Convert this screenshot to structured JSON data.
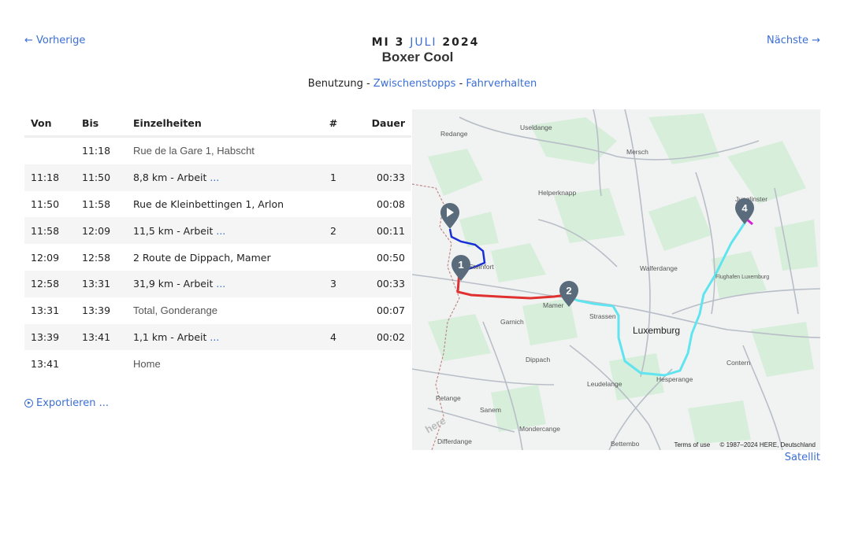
{
  "nav": {
    "prev": "← Vorherige",
    "next": "Nächste →"
  },
  "title": {
    "weekday_day": "MI 3",
    "month": "JULI",
    "year": "2024",
    "vehicle": "Boxer Cool"
  },
  "tabs": {
    "usage": "Benutzung",
    "sep1": " - ",
    "stops": "Zwischenstopps",
    "sep2": " - ",
    "driving": "Fahrverhalten"
  },
  "table": {
    "headers": {
      "from": "Von",
      "to": "Bis",
      "details": "Einzelheiten",
      "num": "#",
      "duration": "Dauer"
    },
    "rows": [
      {
        "from": "",
        "to": "11:18",
        "details": "Rue de la Gare 1, Habscht",
        "more": "",
        "num": "",
        "duration": ""
      },
      {
        "from": "11:18",
        "to": "11:50",
        "details": "8,8 km - Arbeit",
        "more": "...",
        "num": "1",
        "duration": "00:33"
      },
      {
        "from": "11:50",
        "to": "11:58",
        "details": "Rue de Kleinbettingen 1, Arlon",
        "more": "",
        "num": "",
        "duration": "00:08"
      },
      {
        "from": "11:58",
        "to": "12:09",
        "details": "11,5 km - Arbeit",
        "more": "...",
        "num": "2",
        "duration": "00:11"
      },
      {
        "from": "12:09",
        "to": "12:58",
        "details": "2 Route de Dippach, Mamer",
        "more": "",
        "num": "",
        "duration": "00:50"
      },
      {
        "from": "12:58",
        "to": "13:31",
        "details": "31,9 km - Arbeit",
        "more": "...",
        "num": "3",
        "duration": "00:33"
      },
      {
        "from": "13:31",
        "to": "13:39",
        "details": "Total, Gonderange",
        "more": "",
        "num": "",
        "duration": "00:07"
      },
      {
        "from": "13:39",
        "to": "13:41",
        "details": "1,1 km - Arbeit",
        "more": "...",
        "num": "4",
        "duration": "00:02"
      },
      {
        "from": "13:41",
        "to": "",
        "details": "Home",
        "more": "",
        "num": "",
        "duration": ""
      }
    ]
  },
  "export": {
    "label": "Exportieren ..."
  },
  "map": {
    "labels": {
      "useldange": "Useldange",
      "redange": "Redange",
      "mersch": "Mersch",
      "helperknapp": "Helperknapp",
      "walferdange": "Walferdange",
      "steinfort": "Steinfort",
      "mamer": "Mamer",
      "strassen": "Strassen",
      "garnich": "Garnich",
      "luxemburg": "Luxemburg",
      "flughafen": "Flughafen Luxemburg",
      "dippach": "Dippach",
      "contern": "Contern",
      "leudelange": "Leudelange",
      "hesperange": "Hesperange",
      "petange": "Petange",
      "sanem": "Sanem",
      "mondercange": "Mondercange",
      "differdange": "Differdange",
      "bettembourg": "Bettembo",
      "junglinster": "Junglinster",
      "here_logo": "here"
    },
    "markers": [
      "1",
      "2",
      "4"
    ],
    "terms": "Terms of use",
    "copyright": "© 1987–2024 HERE, Deutschland",
    "route_colors": {
      "leg1": "#1a2fd6",
      "leg2": "#e03131",
      "leg3": "#5fe4f0",
      "leg4": "#d61fd6"
    }
  },
  "satellite": "Satellit"
}
